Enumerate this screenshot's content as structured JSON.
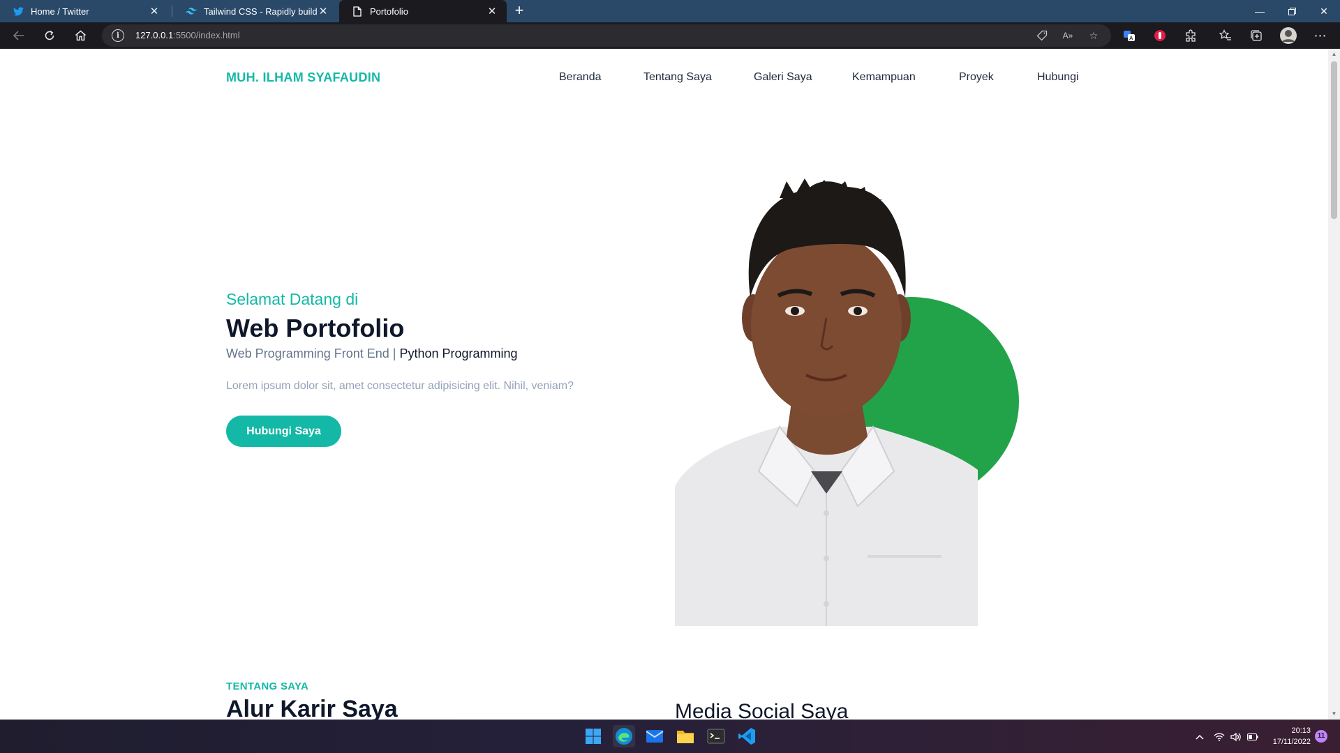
{
  "browser": {
    "tabs": [
      {
        "title": "Home / Twitter",
        "icon": "twitter-icon"
      },
      {
        "title": "Tailwind CSS - Rapidly build moc",
        "icon": "tailwind-icon"
      },
      {
        "title": "Portofolio",
        "icon": "page-icon"
      }
    ],
    "url_host": "127.0.0.1",
    "url_rest": ":5500/index.html"
  },
  "site": {
    "brand": "MUH. ILHAM SYAFAUDIN",
    "nav": [
      "Beranda",
      "Tentang Saya",
      "Galeri Saya",
      "Kemampuan",
      "Proyek",
      "Hubungi"
    ],
    "hero": {
      "welcome": "Selamat Datang di",
      "title": "Web Portofolio",
      "role_part1": "Web Programming Front End | ",
      "role_part2": "Python Programming",
      "description": "Lorem ipsum dolor sit, amet consectetur adipisicing elit. Nihil, veniam?",
      "cta": "Hubungi Saya"
    },
    "about": {
      "label": "TENTANG SAYA",
      "title": "Alur Karir Saya",
      "social_title": "Media Social Saya"
    }
  },
  "taskbar": {
    "time": "20:13",
    "date": "17/11/2022",
    "notifications": "11"
  },
  "colors": {
    "accent": "#14b8a6",
    "blob": "#22a34a",
    "browser_frame": "#2a4868"
  }
}
